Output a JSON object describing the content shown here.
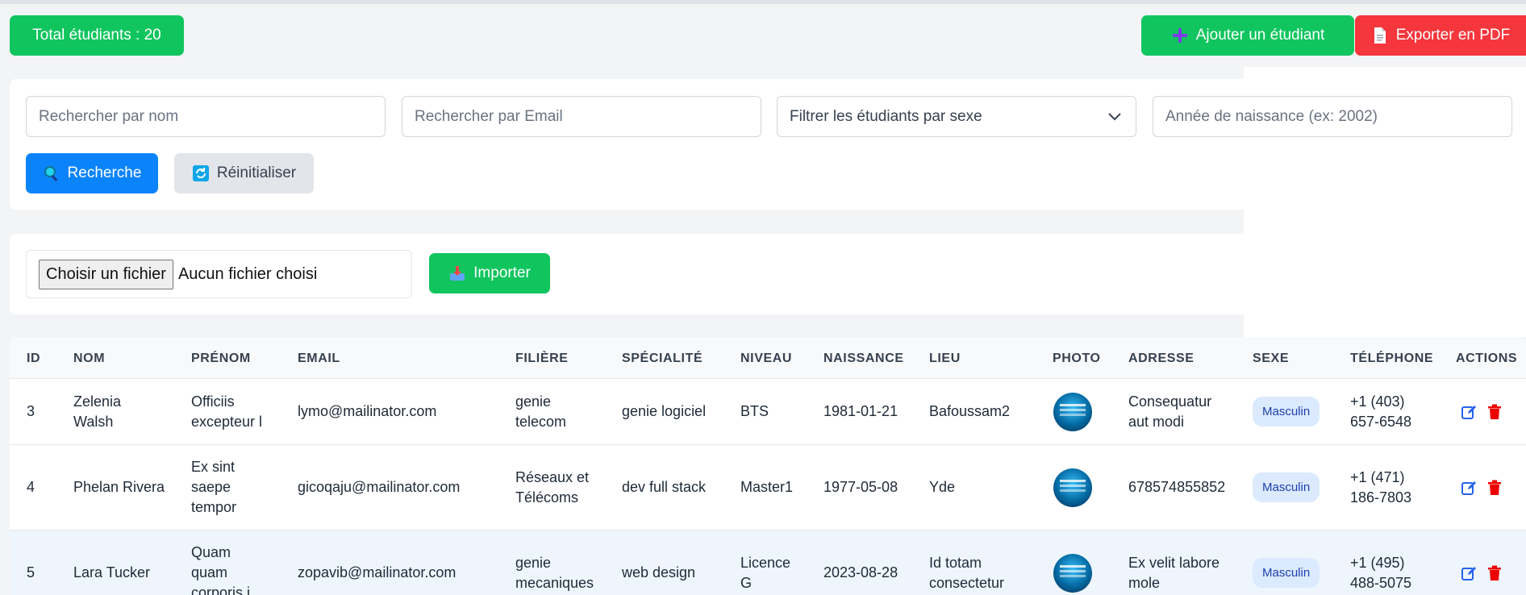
{
  "header": {
    "total_label": "Total étudiants : 20",
    "add_label": "Ajouter un étudiant",
    "export_label": "Exporter en PDF"
  },
  "filters": {
    "name_placeholder": "Rechercher par nom",
    "email_placeholder": "Rechercher par Email",
    "sex_select_value": "Filtrer les étudiants par sexe",
    "year_placeholder": "Année de naissance (ex: 2002)",
    "search_label": "Recherche",
    "reset_label": "Réinitialiser"
  },
  "import": {
    "choose_label": "Choisir un fichier",
    "no_file_label": "Aucun fichier choisi",
    "import_label": "Importer"
  },
  "table": {
    "headers": {
      "id": "ID",
      "nom": "NOM",
      "prenom": "PRÉNOM",
      "email": "EMAIL",
      "filiere": "FILIÈRE",
      "specialite": "SPÉCIALITÉ",
      "niveau": "NIVEAU",
      "naissance": "NAISSANCE",
      "lieu": "LIEU",
      "photo": "PHOTO",
      "adresse": "ADRESSE",
      "sexe": "SEXE",
      "telephone": "TÉLÉPHONE",
      "actions": "ACTIONS"
    },
    "rows": [
      {
        "id": "3",
        "nom_1": "Zelenia",
        "nom_2": "Walsh",
        "prenom_1": "Officiis",
        "prenom_2": "excepteur l",
        "prenom_3": "",
        "email": "lymo@mailinator.com",
        "filiere_1": "genie",
        "filiere_2": "telecom",
        "specialite": "genie logiciel",
        "niveau_1": "BTS",
        "niveau_2": "",
        "naissance": "1981-01-21",
        "lieu_1": "Bafoussam2",
        "lieu_2": "",
        "adresse_1": "Consequatur",
        "adresse_2": "aut modi",
        "sexe": "Masculin",
        "tel_1": "+1 (403)",
        "tel_2": "657-6548"
      },
      {
        "id": "4",
        "nom_1": "Phelan Rivera",
        "nom_2": "",
        "prenom_1": "Ex sint",
        "prenom_2": "saepe",
        "prenom_3": "tempor",
        "email": "gicoqaju@mailinator.com",
        "filiere_1": "Réseaux et",
        "filiere_2": "Télécoms",
        "specialite": "dev full stack",
        "niveau_1": "Master1",
        "niveau_2": "",
        "naissance": "1977-05-08",
        "lieu_1": "Yde",
        "lieu_2": "",
        "adresse_1": "678574855852",
        "adresse_2": "",
        "sexe": "Masculin",
        "tel_1": "+1 (471)",
        "tel_2": "186-7803"
      },
      {
        "id": "5",
        "nom_1": "Lara Tucker",
        "nom_2": "",
        "prenom_1": "Quam",
        "prenom_2": "quam",
        "prenom_3": "corporis i",
        "email": "zopavib@mailinator.com",
        "filiere_1": "genie",
        "filiere_2": "mecaniques",
        "specialite": "web design",
        "niveau_1": "Licence",
        "niveau_2": "G",
        "naissance": "2023-08-28",
        "lieu_1": "Id totam",
        "lieu_2": "consectetur",
        "adresse_1": "Ex velit labore",
        "adresse_2": "mole",
        "sexe": "Masculin",
        "tel_1": "+1 (495)",
        "tel_2": "488-5075"
      }
    ]
  },
  "colors": {
    "green": "#10c55e",
    "red": "#f5363c",
    "blue": "#0b84fb",
    "icons": {
      "plus-icon": "#7c3aed",
      "document-icon": "#ffffff",
      "magnifier-icon": "#22d3ee",
      "refresh-icon": "#0ea5e9",
      "inbox-tray-icon": "#ef4444",
      "edit-icon": "#2563eb",
      "trash-icon": "#ef0000"
    }
  }
}
